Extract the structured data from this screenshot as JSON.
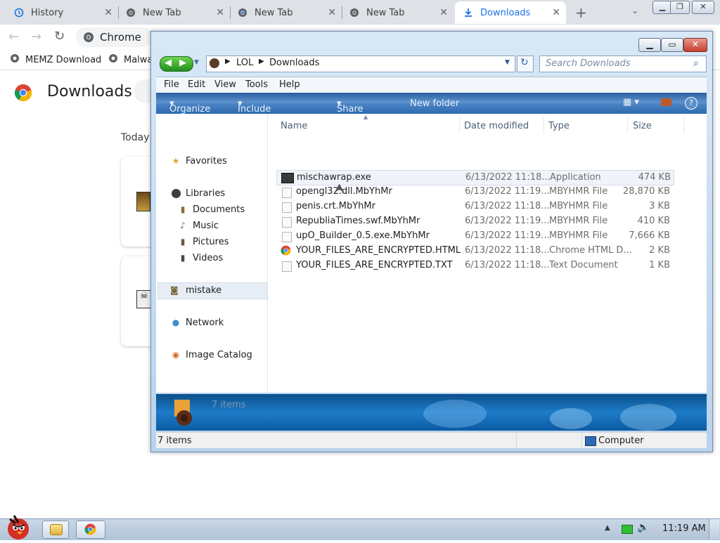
{
  "chrome": {
    "tabs": [
      {
        "label": "History",
        "icon": "history-icon",
        "active": false
      },
      {
        "label": "New Tab",
        "icon": "chrome-tab-icon",
        "active": false
      },
      {
        "label": "New Tab",
        "icon": "chrome-tab-icon",
        "active": false
      },
      {
        "label": "New Tab",
        "icon": "chrome-tab-icon",
        "active": false
      },
      {
        "label": "Downloads",
        "icon": "download-icon",
        "active": true
      }
    ],
    "omnibox_text": "Chrome",
    "bookmarks": [
      {
        "label": "MEMZ Download"
      },
      {
        "label": "Malwa"
      }
    ],
    "page_title": "Downloads",
    "today_label": "Today"
  },
  "explorer": {
    "breadcrumb": [
      "LOL",
      "Downloads"
    ],
    "search_placeholder": "Search Downloads",
    "menu": [
      "File",
      "Edit",
      "View",
      "Tools",
      "Help"
    ],
    "commands": [
      "Organize",
      "Include in library",
      "Share with",
      "New folder"
    ],
    "nav": {
      "favorites": "Favorites",
      "libraries": "Libraries",
      "library_items": [
        "Documents",
        "Music",
        "Pictures",
        "Videos"
      ],
      "user_folder": "mistake",
      "network": "Network",
      "catalog": "Image Catalog"
    },
    "columns": {
      "name": "Name",
      "date": "Date modified",
      "type": "Type",
      "size": "Size"
    },
    "files": [
      {
        "name": "mischawrap.exe",
        "date": "6/13/2022 11:18...",
        "type": "Application",
        "size": "474 KB"
      },
      {
        "name": "opengl32.dll.MbYhMr",
        "date": "6/13/2022 11:19...",
        "type": "MBYHMR File",
        "size": "28,870 KB"
      },
      {
        "name": "penis.crt.MbYhMr",
        "date": "6/13/2022 11:18...",
        "type": "MBYHMR File",
        "size": "3 KB"
      },
      {
        "name": "RepubliaTimes.swf.MbYhMr",
        "date": "6/13/2022 11:19...",
        "type": "MBYHMR File",
        "size": "410 KB"
      },
      {
        "name": "upO_Builder_0.5.exe.MbYhMr",
        "date": "6/13/2022 11:19...",
        "type": "MBYHMR File",
        "size": "7,666 KB"
      },
      {
        "name": "YOUR_FILES_ARE_ENCRYPTED.HTML",
        "date": "6/13/2022 11:18...",
        "type": "Chrome HTML D...",
        "size": "2 KB"
      },
      {
        "name": "YOUR_FILES_ARE_ENCRYPTED.TXT",
        "date": "6/13/2022 11:18...",
        "type": "Text Document",
        "size": "1 KB"
      }
    ],
    "details_count": "7 items",
    "status_count": "7 items",
    "status_location": "Computer"
  },
  "taskbar": {
    "clock": "11:19 AM"
  },
  "colors": {
    "chrome_tabstrip": "#dee1e6",
    "explorer_frame": "#c6dcf2",
    "command_bar": "#3d78bd",
    "close_red": "#d9473b",
    "nav_green": "#3cae3f"
  }
}
